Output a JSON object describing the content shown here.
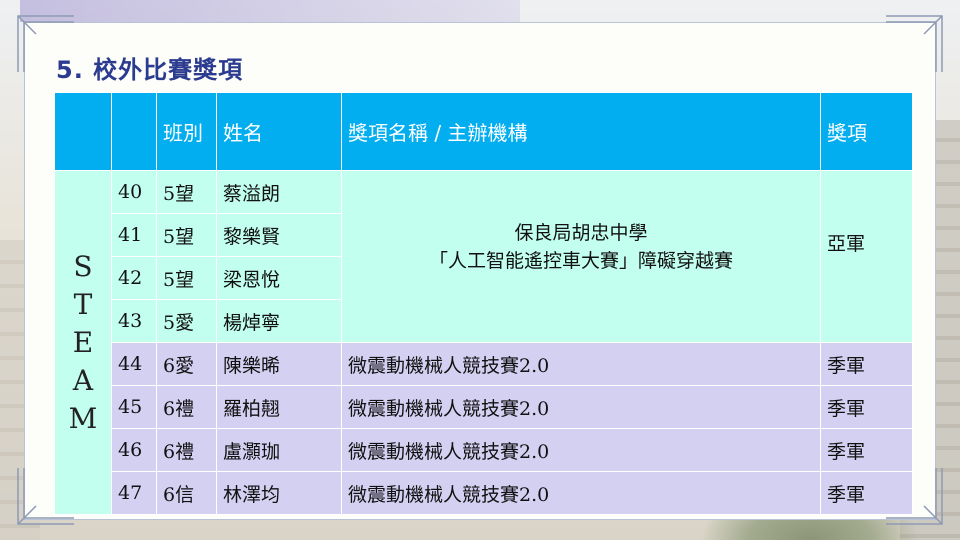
{
  "title": "5. 校外比賽獎項",
  "headers": {
    "c1": "",
    "c2": "",
    "class": "班別",
    "name": "姓名",
    "award": "獎項名稱 / 主辦機構",
    "prize": "獎項"
  },
  "category_letters": [
    "S",
    "T",
    "E",
    "A",
    "M"
  ],
  "group1": {
    "award_line1": "保良局胡忠中學",
    "award_line2": "「人工智能遙控車大賽」障礙穿越賽",
    "prize": "亞軍",
    "rows": [
      {
        "no": "40",
        "cls": "5望",
        "name": "蔡溢朗"
      },
      {
        "no": "41",
        "cls": "5望",
        "name": "黎樂賢"
      },
      {
        "no": "42",
        "cls": "5望",
        "name": "梁恩悅"
      },
      {
        "no": "43",
        "cls": "5愛",
        "name": "楊焯寧"
      }
    ]
  },
  "group2": [
    {
      "no": "44",
      "cls": "6愛",
      "name": "陳樂晞",
      "award": "微震動機械人競技賽2.0",
      "prize": "季軍"
    },
    {
      "no": "45",
      "cls": "6禮",
      "name": "羅柏翹",
      "award": "微震動機械人競技賽2.0",
      "prize": "季軍"
    },
    {
      "no": "46",
      "cls": "6禮",
      "name": "盧灝珈",
      "award": "微震動機械人競技賽2.0",
      "prize": "季軍"
    },
    {
      "no": "47",
      "cls": "6信",
      "name": "林澤均",
      "award": "微震動機械人競技賽2.0",
      "prize": "季軍"
    }
  ],
  "colors": {
    "header": "#02aeef",
    "category": "#fcbc00",
    "group1": "#c2ffee",
    "group2": "#d4d0f2",
    "title": "#2b3b8f"
  }
}
